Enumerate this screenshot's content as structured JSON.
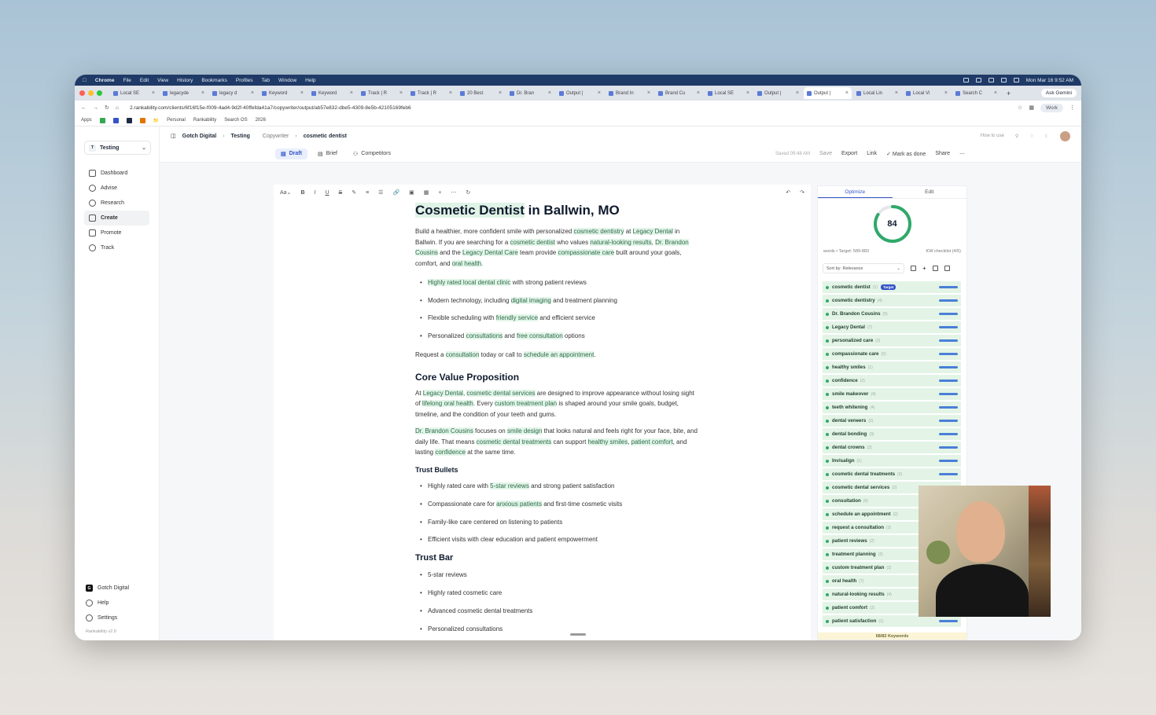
{
  "menubar": {
    "app": "Chrome",
    "items": [
      "File",
      "Edit",
      "View",
      "History",
      "Bookmarks",
      "Profiles",
      "Tab",
      "Window",
      "Help"
    ],
    "clock": "Mon Mar 16  9:52 AM"
  },
  "tabs": [
    {
      "label": "Local SE"
    },
    {
      "label": "legacyde"
    },
    {
      "label": "legacy d"
    },
    {
      "label": "Keyword"
    },
    {
      "label": "Keyword"
    },
    {
      "label": "Track | R"
    },
    {
      "label": "Track | R"
    },
    {
      "label": "20 Best"
    },
    {
      "label": "Dr. Bran"
    },
    {
      "label": "Output |"
    },
    {
      "label": "Brand In"
    },
    {
      "label": "Brand Cu"
    },
    {
      "label": "Local SE"
    },
    {
      "label": "Output |"
    },
    {
      "label": "Output |"
    },
    {
      "label": "Local Lin"
    },
    {
      "label": "Local Vi"
    },
    {
      "label": "Search C"
    }
  ],
  "browser": {
    "gemini": "Ask Gemini",
    "url": "2.rankability.com/clients/6f16f15e-f009-4ad4-9d2f-40ffefda41a7/copywriter/output/ab57e832-dbe5-4309-8e5b-42105169feb6",
    "profile": "Work",
    "bookmarks": [
      "Apps",
      "Personal",
      "Rankability",
      "Search OS",
      "2026"
    ]
  },
  "sidebar": {
    "workspace": "Testing",
    "workspace_initial": "T",
    "items": [
      "Dashboard",
      "Advise",
      "Research",
      "Create",
      "Promote",
      "Track"
    ],
    "bottom": [
      "Gotch Digital",
      "Help",
      "Settings"
    ],
    "version": "Rankability v2.0"
  },
  "header": {
    "client": "Gotch Digital",
    "project": "Testing",
    "section": "Copywriter",
    "page": "cosmetic dentist",
    "how_to": "How to use"
  },
  "modes": {
    "draft": "Draft",
    "brief": "Brief",
    "competitors": "Competitors",
    "saved": "Saved 09:48 AM",
    "save": "Save",
    "export": "Export",
    "link": "Link",
    "done": "Mark as done",
    "share": "Share"
  },
  "doc": {
    "title_kw": "Cosmetic Dentist",
    "title_rest": " in Ballwin, MO",
    "h_core": "Core Value Proposition",
    "h_bullets": "Trust Bullets",
    "h_bar": "Trust Bar"
  },
  "panel": {
    "tab_optimize": "Optimize",
    "tab_edit": "Edit",
    "score": "84",
    "words": "words • Target: 589-883",
    "kw_checklist": "KW checklist (4/5)",
    "sort": "Sort by: Relevance",
    "target_badge": "Target",
    "footer": "68/82 Keywords",
    "keywords": [
      {
        "term": "cosmetic dentist",
        "count": "(1)"
      },
      {
        "term": "cosmetic dentistry",
        "count": "(4)"
      },
      {
        "term": "Dr. Brandon Cousins",
        "count": "(5)"
      },
      {
        "term": "Legacy Dental",
        "count": "(7)"
      },
      {
        "term": "personalized care",
        "count": "(2)"
      },
      {
        "term": "compassionate care",
        "count": "(2)"
      },
      {
        "term": "healthy smiles",
        "count": "(1)"
      },
      {
        "term": "confidence",
        "count": "(2)"
      },
      {
        "term": "smile makeover",
        "count": "(4)"
      },
      {
        "term": "teeth whitening",
        "count": "(4)"
      },
      {
        "term": "dental veneers",
        "count": "(2)"
      },
      {
        "term": "dental bonding",
        "count": "(3)"
      },
      {
        "term": "dental crowns",
        "count": "(2)"
      },
      {
        "term": "Invisalign",
        "count": "(1)"
      },
      {
        "term": "cosmetic dental treatments",
        "count": "(3)"
      },
      {
        "term": "cosmetic dental services",
        "count": "(2)"
      },
      {
        "term": "consultation",
        "count": "(6)"
      },
      {
        "term": "schedule an appointment",
        "count": "(2)"
      },
      {
        "term": "request a consultation",
        "count": "(3)"
      },
      {
        "term": "patient reviews",
        "count": "(2)"
      },
      {
        "term": "treatment planning",
        "count": "(2)"
      },
      {
        "term": "custom treatment plan",
        "count": "(1)"
      },
      {
        "term": "oral health",
        "count": "(7)"
      },
      {
        "term": "natural-looking results",
        "count": "(4)"
      },
      {
        "term": "patient comfort",
        "count": "(2)"
      },
      {
        "term": "patient satisfaction",
        "count": "(1)"
      }
    ]
  },
  "colors": {
    "accent": "#3553c7",
    "highlight": "#e3f5e9",
    "score_ring": "#2fa96a"
  }
}
